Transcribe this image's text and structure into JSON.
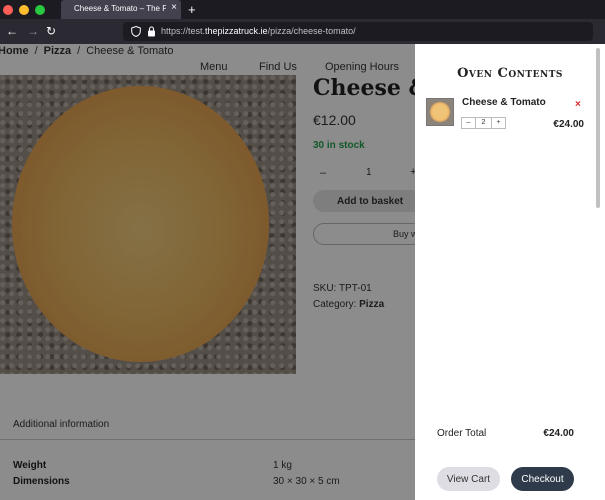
{
  "browser": {
    "tab_title": "Cheese & Tomato – The Pizza T",
    "tab_close_glyph": "×",
    "new_tab_glyph": "+",
    "back_glyph": "←",
    "forward_glyph": "→",
    "reload_glyph": "↻",
    "url_prefix": "https://test.",
    "url_domain": "thepizzatruck.ie",
    "url_path": "/pizza/cheese-tomato/",
    "traffic_light_colors": [
      "#ff5f57",
      "#febc2e",
      "#28c840"
    ],
    "icons": [
      "back-icon",
      "forward-icon",
      "reload-icon",
      "shield-icon",
      "lock-icon"
    ]
  },
  "page": {
    "breadcrumb": [
      {
        "label": "Home",
        "bold": true
      },
      {
        "label": "Pizza",
        "bold": true
      },
      {
        "label": "Cheese & Tomato",
        "bold": false
      }
    ],
    "breadcrumb_sep": "/",
    "menu": [
      "Menu",
      "Find Us",
      "Opening Hours"
    ],
    "product": {
      "title": "Cheese &",
      "price": "€12.00",
      "stock": "30 in stock",
      "qty_minus": "–",
      "qty_value": "1",
      "qty_plus": "+",
      "add_to_basket": "Add to basket",
      "buy_now": "Buy w",
      "sku_label": "SKU:",
      "sku_value": "TPT-01",
      "category_label": "Category:",
      "category_value": "Pizza"
    },
    "additional_info_tab": "Additional information",
    "attributes": [
      {
        "label": "Weight",
        "value": "1 kg"
      },
      {
        "label": "Dimensions",
        "value": "30 × 30 × 5 cm"
      }
    ],
    "stock_color": "#22a04b"
  },
  "cart": {
    "title": "Oven Contents",
    "items": [
      {
        "name": "Cheese & Tomato",
        "qty": "2",
        "price": "€24.00",
        "remove_glyph": "×",
        "minus": "–",
        "plus": "+"
      }
    ],
    "total_label": "Order Total",
    "total_value": "€24.00",
    "view_cart": "View Cart",
    "checkout": "Checkout",
    "checkout_color": "#2f3b4a"
  }
}
